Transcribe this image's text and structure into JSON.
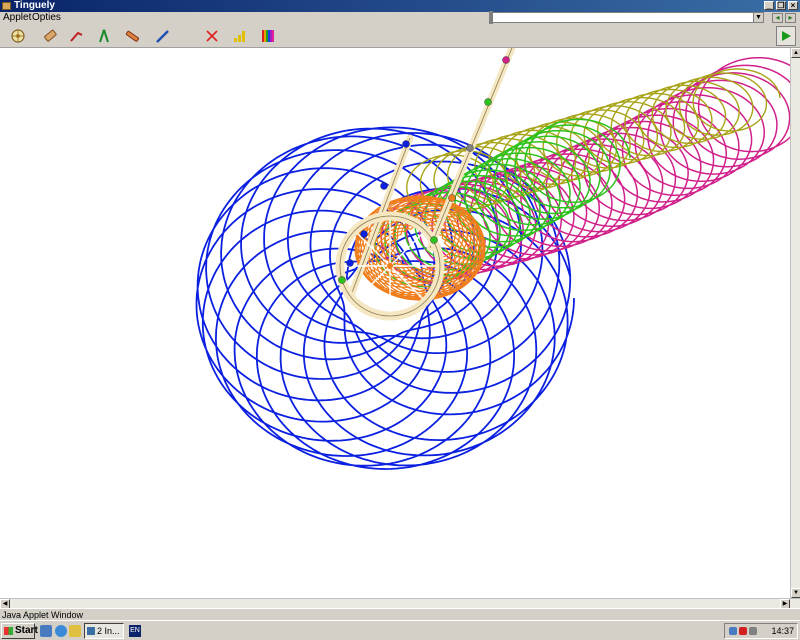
{
  "window": {
    "title": "Tinguely",
    "icon": "applet-icon"
  },
  "window_controls": [
    {
      "name": "minimize-button",
      "glyph": "_"
    },
    {
      "name": "restore-button",
      "glyph": "❐"
    },
    {
      "name": "close-button",
      "glyph": "×"
    }
  ],
  "menu": [
    {
      "label": "Applet"
    },
    {
      "label": "Opties"
    }
  ],
  "address_combo": {
    "value": ""
  },
  "toolbar": {
    "tools": [
      {
        "name": "wheel-tool",
        "icon": "wheel-icon"
      },
      {
        "name": "eraser-tool",
        "icon": "eraser-icon"
      },
      {
        "name": "crank-tool",
        "icon": "crank-icon"
      },
      {
        "name": "compass-tool",
        "icon": "compass-icon"
      },
      {
        "name": "rod-tool",
        "icon": "rod-icon"
      },
      {
        "name": "pen-tool",
        "icon": "pen-icon"
      },
      {
        "name": "delete-tool",
        "icon": "x-icon"
      },
      {
        "name": "speed-tool",
        "icon": "bars-icon"
      },
      {
        "name": "colors-tool",
        "icon": "colors-icon"
      }
    ],
    "play_icon": "play-icon"
  },
  "colors": {
    "blue": "#0b20e0",
    "magenta": "#d0208a",
    "green": "#2ec21c",
    "olive": "#a8a418",
    "orange": "#f07e1c",
    "rod": "#f4e7c2"
  },
  "status": {
    "text": "Java Applet Window"
  },
  "taskbar": {
    "start_label": "Start",
    "task_label": "2 In...",
    "lang": "EN",
    "clock": "14:37"
  }
}
